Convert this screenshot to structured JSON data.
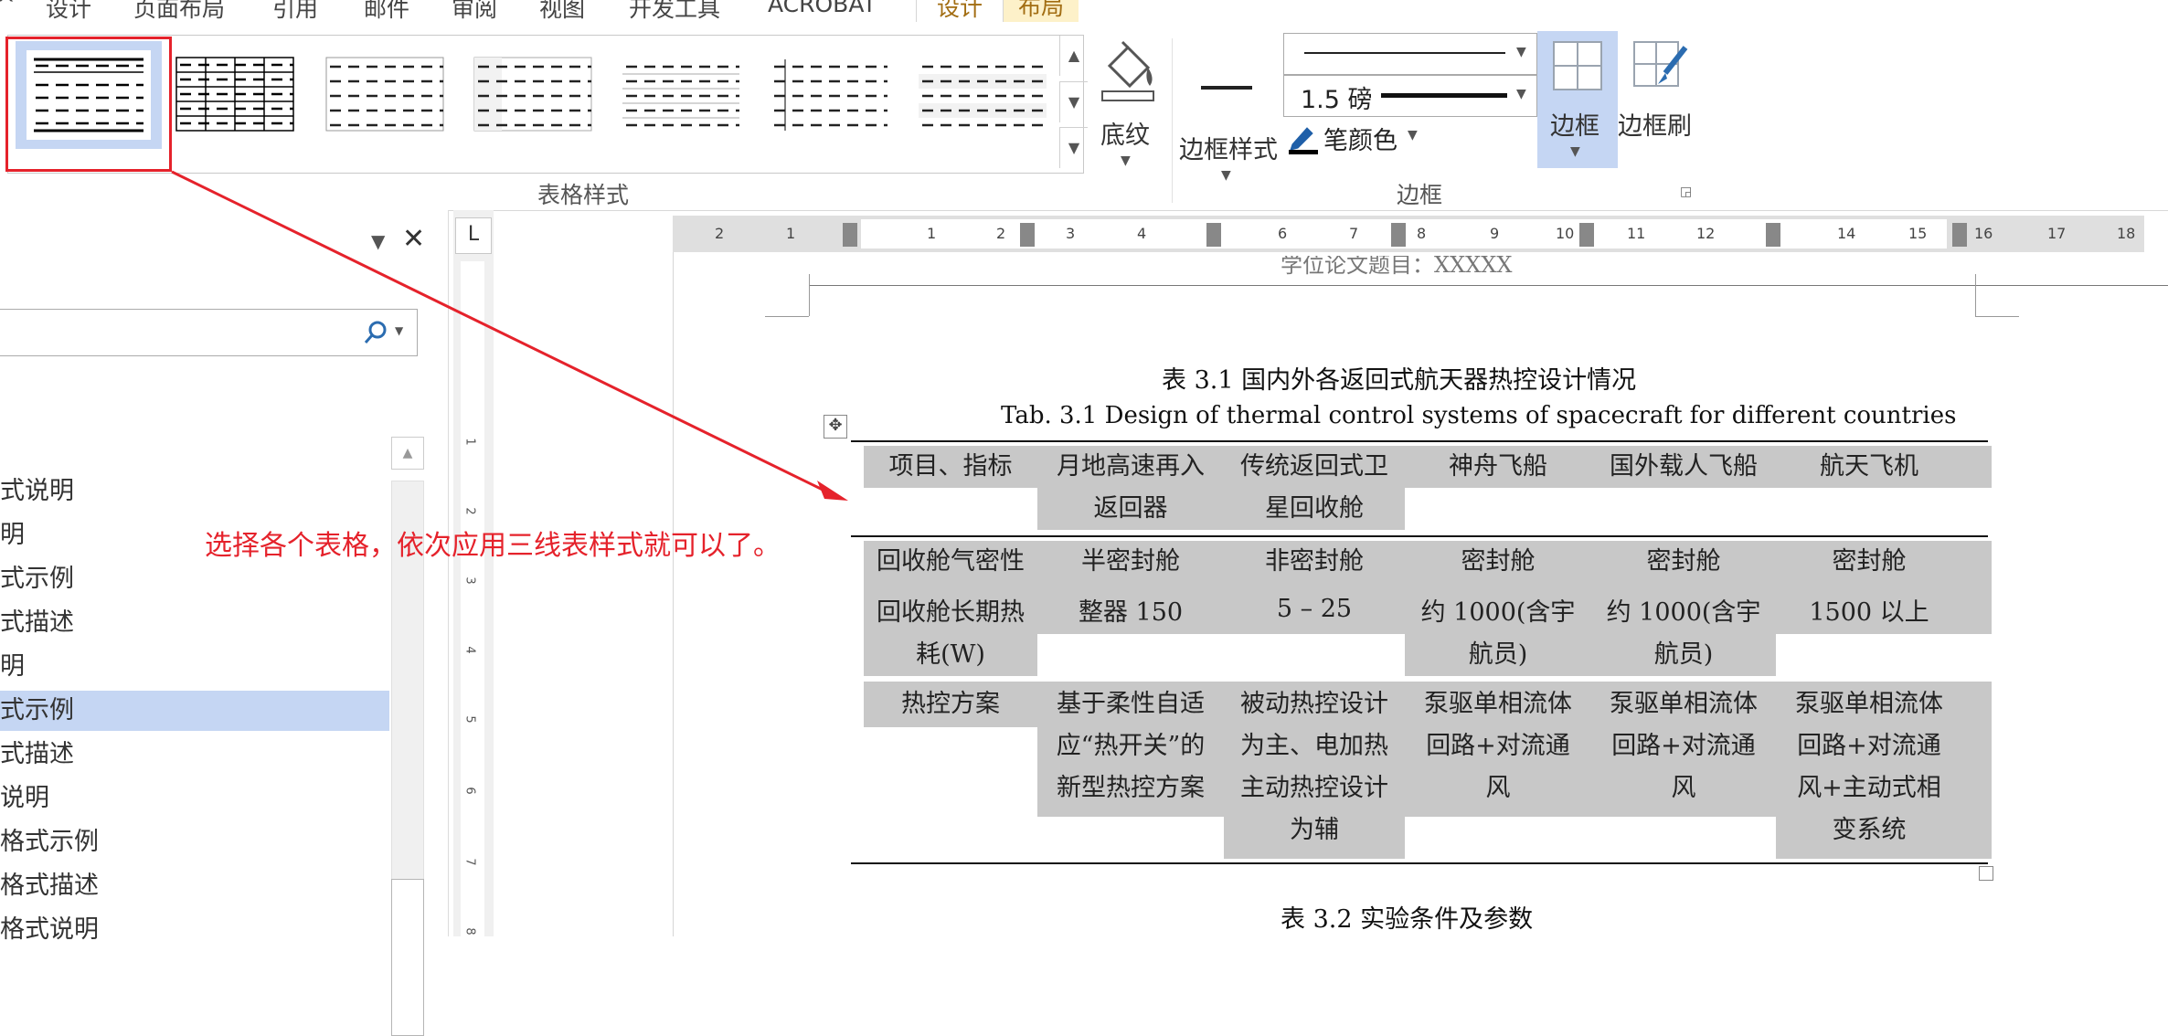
{
  "menubar": {
    "tabs": [
      "设计",
      "页面布局",
      "引用",
      "邮件",
      "审阅",
      "视图",
      "开发工具",
      "ACROBAT",
      "设计",
      "布局"
    ]
  },
  "ribbon": {
    "table_styles_label": "表格样式",
    "shading_label": "底纹",
    "border_style_label": "边框样式",
    "line_weight": "1.5 磅",
    "pen_color_label": "笔颜色",
    "borders_label": "边框",
    "border_painter_label": "边框刷",
    "borders_group_label": "边框"
  },
  "navpane": {
    "items": [
      "式说明",
      "明",
      "式示例",
      "式描述",
      "明",
      "式示例",
      "式描述",
      "说明",
      "格式示例",
      "格式描述",
      "格式说明"
    ],
    "selected_index": 5
  },
  "hruler": {
    "numbers": [
      "2",
      "1",
      "1",
      "2",
      "3",
      "4",
      "6",
      "7",
      "8",
      "9",
      "10",
      "11",
      "12",
      "14",
      "15",
      "16",
      "17",
      "18"
    ]
  },
  "vruler": {
    "numbers": [
      "1",
      "2",
      "3",
      "4",
      "5",
      "6",
      "7",
      "8"
    ]
  },
  "document": {
    "header_text": "学位论文题目：XXXXX",
    "caption_cn": "表 3.1  国内外各返回式航天器热控设计情况",
    "caption_en": "Tab. 3.1 Design of thermal control systems of spacecraft for different countries",
    "table": {
      "headers": [
        [
          "项目、指标"
        ],
        [
          "月地高速再入",
          "返回器"
        ],
        [
          "传统返回式卫",
          "星回收舱"
        ],
        [
          "神舟飞船"
        ],
        [
          "国外载人飞船"
        ],
        [
          "航天飞机"
        ]
      ],
      "rows": [
        [
          [
            "回收舱气密性"
          ],
          [
            "半密封舱"
          ],
          [
            "非密封舱"
          ],
          [
            "密封舱"
          ],
          [
            "密封舱"
          ],
          [
            "密封舱"
          ]
        ],
        [
          [
            "回收舱长期热",
            "耗(W)"
          ],
          [
            "整器 150"
          ],
          [
            "5 – 25"
          ],
          [
            "约 1000(含宇",
            "航员)"
          ],
          [
            "约 1000(含宇",
            "航员)"
          ],
          [
            "1500 以上"
          ]
        ],
        [
          [
            "热控方案"
          ],
          [
            "基于柔性自适",
            "应“热开关”的",
            "新型热控方案"
          ],
          [
            "被动热控设计",
            "为主、电加热",
            "主动热控设计",
            "为辅"
          ],
          [
            "泵驱单相流体",
            "回路+对流通",
            "风"
          ],
          [
            "泵驱单相流体",
            "回路+对流通",
            "风"
          ],
          [
            "泵驱单相流体",
            "回路+对流通",
            "风+主动式相",
            "变系统"
          ]
        ]
      ]
    },
    "caption2_cn": "表 3.2  实验条件及参数"
  },
  "annotation": {
    "text": "选择各个表格，依次应用三线表样式就可以了。",
    "color": "#e5222b"
  }
}
